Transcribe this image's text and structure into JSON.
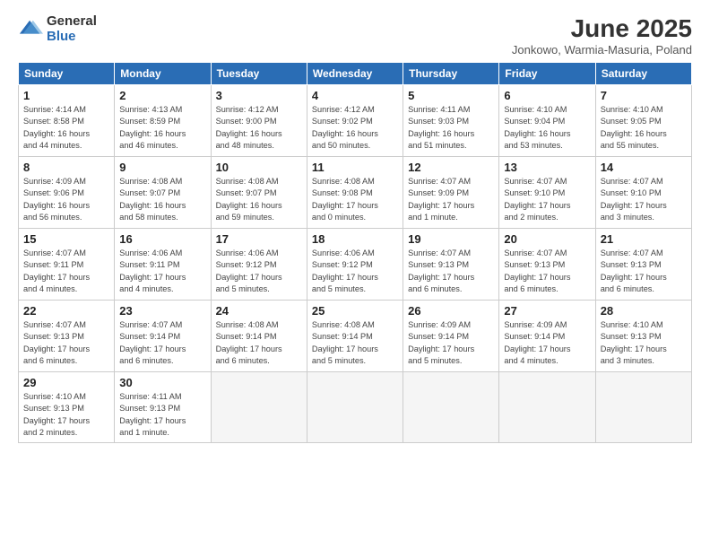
{
  "logo": {
    "general": "General",
    "blue": "Blue"
  },
  "title": "June 2025",
  "subtitle": "Jonkowo, Warmia-Masuria, Poland",
  "weekdays": [
    "Sunday",
    "Monday",
    "Tuesday",
    "Wednesday",
    "Thursday",
    "Friday",
    "Saturday"
  ],
  "weeks": [
    [
      {
        "day": "1",
        "info": "Sunrise: 4:14 AM\nSunset: 8:58 PM\nDaylight: 16 hours\nand 44 minutes."
      },
      {
        "day": "2",
        "info": "Sunrise: 4:13 AM\nSunset: 8:59 PM\nDaylight: 16 hours\nand 46 minutes."
      },
      {
        "day": "3",
        "info": "Sunrise: 4:12 AM\nSunset: 9:00 PM\nDaylight: 16 hours\nand 48 minutes."
      },
      {
        "day": "4",
        "info": "Sunrise: 4:12 AM\nSunset: 9:02 PM\nDaylight: 16 hours\nand 50 minutes."
      },
      {
        "day": "5",
        "info": "Sunrise: 4:11 AM\nSunset: 9:03 PM\nDaylight: 16 hours\nand 51 minutes."
      },
      {
        "day": "6",
        "info": "Sunrise: 4:10 AM\nSunset: 9:04 PM\nDaylight: 16 hours\nand 53 minutes."
      },
      {
        "day": "7",
        "info": "Sunrise: 4:10 AM\nSunset: 9:05 PM\nDaylight: 16 hours\nand 55 minutes."
      }
    ],
    [
      {
        "day": "8",
        "info": "Sunrise: 4:09 AM\nSunset: 9:06 PM\nDaylight: 16 hours\nand 56 minutes."
      },
      {
        "day": "9",
        "info": "Sunrise: 4:08 AM\nSunset: 9:07 PM\nDaylight: 16 hours\nand 58 minutes."
      },
      {
        "day": "10",
        "info": "Sunrise: 4:08 AM\nSunset: 9:07 PM\nDaylight: 16 hours\nand 59 minutes."
      },
      {
        "day": "11",
        "info": "Sunrise: 4:08 AM\nSunset: 9:08 PM\nDaylight: 17 hours\nand 0 minutes."
      },
      {
        "day": "12",
        "info": "Sunrise: 4:07 AM\nSunset: 9:09 PM\nDaylight: 17 hours\nand 1 minute."
      },
      {
        "day": "13",
        "info": "Sunrise: 4:07 AM\nSunset: 9:10 PM\nDaylight: 17 hours\nand 2 minutes."
      },
      {
        "day": "14",
        "info": "Sunrise: 4:07 AM\nSunset: 9:10 PM\nDaylight: 17 hours\nand 3 minutes."
      }
    ],
    [
      {
        "day": "15",
        "info": "Sunrise: 4:07 AM\nSunset: 9:11 PM\nDaylight: 17 hours\nand 4 minutes."
      },
      {
        "day": "16",
        "info": "Sunrise: 4:06 AM\nSunset: 9:11 PM\nDaylight: 17 hours\nand 4 minutes."
      },
      {
        "day": "17",
        "info": "Sunrise: 4:06 AM\nSunset: 9:12 PM\nDaylight: 17 hours\nand 5 minutes."
      },
      {
        "day": "18",
        "info": "Sunrise: 4:06 AM\nSunset: 9:12 PM\nDaylight: 17 hours\nand 5 minutes."
      },
      {
        "day": "19",
        "info": "Sunrise: 4:07 AM\nSunset: 9:13 PM\nDaylight: 17 hours\nand 6 minutes."
      },
      {
        "day": "20",
        "info": "Sunrise: 4:07 AM\nSunset: 9:13 PM\nDaylight: 17 hours\nand 6 minutes."
      },
      {
        "day": "21",
        "info": "Sunrise: 4:07 AM\nSunset: 9:13 PM\nDaylight: 17 hours\nand 6 minutes."
      }
    ],
    [
      {
        "day": "22",
        "info": "Sunrise: 4:07 AM\nSunset: 9:13 PM\nDaylight: 17 hours\nand 6 minutes."
      },
      {
        "day": "23",
        "info": "Sunrise: 4:07 AM\nSunset: 9:14 PM\nDaylight: 17 hours\nand 6 minutes."
      },
      {
        "day": "24",
        "info": "Sunrise: 4:08 AM\nSunset: 9:14 PM\nDaylight: 17 hours\nand 6 minutes."
      },
      {
        "day": "25",
        "info": "Sunrise: 4:08 AM\nSunset: 9:14 PM\nDaylight: 17 hours\nand 5 minutes."
      },
      {
        "day": "26",
        "info": "Sunrise: 4:09 AM\nSunset: 9:14 PM\nDaylight: 17 hours\nand 5 minutes."
      },
      {
        "day": "27",
        "info": "Sunrise: 4:09 AM\nSunset: 9:14 PM\nDaylight: 17 hours\nand 4 minutes."
      },
      {
        "day": "28",
        "info": "Sunrise: 4:10 AM\nSunset: 9:13 PM\nDaylight: 17 hours\nand 3 minutes."
      }
    ],
    [
      {
        "day": "29",
        "info": "Sunrise: 4:10 AM\nSunset: 9:13 PM\nDaylight: 17 hours\nand 2 minutes."
      },
      {
        "day": "30",
        "info": "Sunrise: 4:11 AM\nSunset: 9:13 PM\nDaylight: 17 hours\nand 1 minute."
      },
      {
        "day": "",
        "info": ""
      },
      {
        "day": "",
        "info": ""
      },
      {
        "day": "",
        "info": ""
      },
      {
        "day": "",
        "info": ""
      },
      {
        "day": "",
        "info": ""
      }
    ]
  ]
}
